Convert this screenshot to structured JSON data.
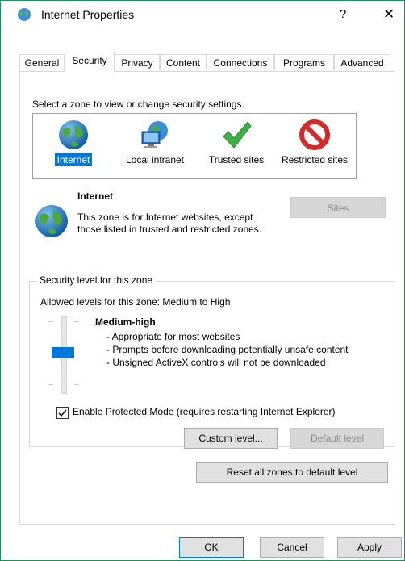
{
  "window": {
    "title": "Internet Properties",
    "help_label": "?",
    "close_label": "✕"
  },
  "tabs": [
    {
      "label": "General"
    },
    {
      "label": "Security",
      "active": true
    },
    {
      "label": "Privacy"
    },
    {
      "label": "Content"
    },
    {
      "label": "Connections"
    },
    {
      "label": "Programs"
    },
    {
      "label": "Advanced"
    }
  ],
  "zones": {
    "instruction": "Select a zone to view or change security settings.",
    "items": [
      {
        "label": "Internet",
        "icon": "globe-icon",
        "selected": true
      },
      {
        "label": "Local intranet",
        "icon": "intranet-icon"
      },
      {
        "label": "Trusted sites",
        "icon": "checkmark-icon"
      },
      {
        "label": "Restricted sites",
        "icon": "restricted-icon"
      }
    ]
  },
  "zone_info": {
    "name": "Internet",
    "description": "This zone is for Internet websites, except those listed in trusted and restricted zones.",
    "sites_label": "Sites"
  },
  "security_level": {
    "group_label": "Security level for this zone",
    "allowed": "Allowed levels for this zone: Medium to High",
    "level_name": "Medium-high",
    "bullets": [
      "- Appropriate for most websites",
      "- Prompts before downloading potentially unsafe content",
      "- Unsigned ActiveX controls will not be downloaded"
    ],
    "protected_mode_label": "Enable Protected Mode (requires restarting Internet Explorer)",
    "protected_mode_checked": true,
    "custom_label": "Custom level...",
    "default_label": "Default level"
  },
  "reset_label": "Reset all zones to default level",
  "footer": {
    "ok": "OK",
    "cancel": "Cancel",
    "apply": "Apply"
  },
  "colors": {
    "accent": "#0078d7",
    "border": "#1f8f5a",
    "disabled_bg": "#d7d7d7"
  }
}
